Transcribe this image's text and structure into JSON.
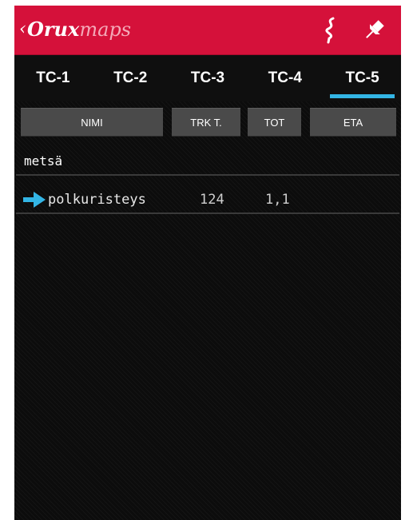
{
  "app": {
    "logo_part1": "Orux",
    "logo_part2": "maps",
    "up_caret": "‹",
    "accent_color": "#d5113a",
    "actions": [
      {
        "icon": "route-squiggle-icon"
      },
      {
        "icon": "pin-icon"
      }
    ]
  },
  "tabs": [
    {
      "label": "TC-1",
      "selected": false
    },
    {
      "label": "TC-2",
      "selected": false
    },
    {
      "label": "TC-3",
      "selected": false
    },
    {
      "label": "TC-4",
      "selected": false
    },
    {
      "label": "TC-5",
      "selected": true
    }
  ],
  "tab_indicator_color": "#33b5e5",
  "columns": {
    "name": "NIMI",
    "track": "TRK T.",
    "total": "TOT",
    "eta": "ETA"
  },
  "group": {
    "label": "metsä"
  },
  "rows": [
    {
      "icon": "arrow-right-icon",
      "name": "polkuristeys",
      "track": "124",
      "total": "1,1",
      "eta": ""
    }
  ]
}
